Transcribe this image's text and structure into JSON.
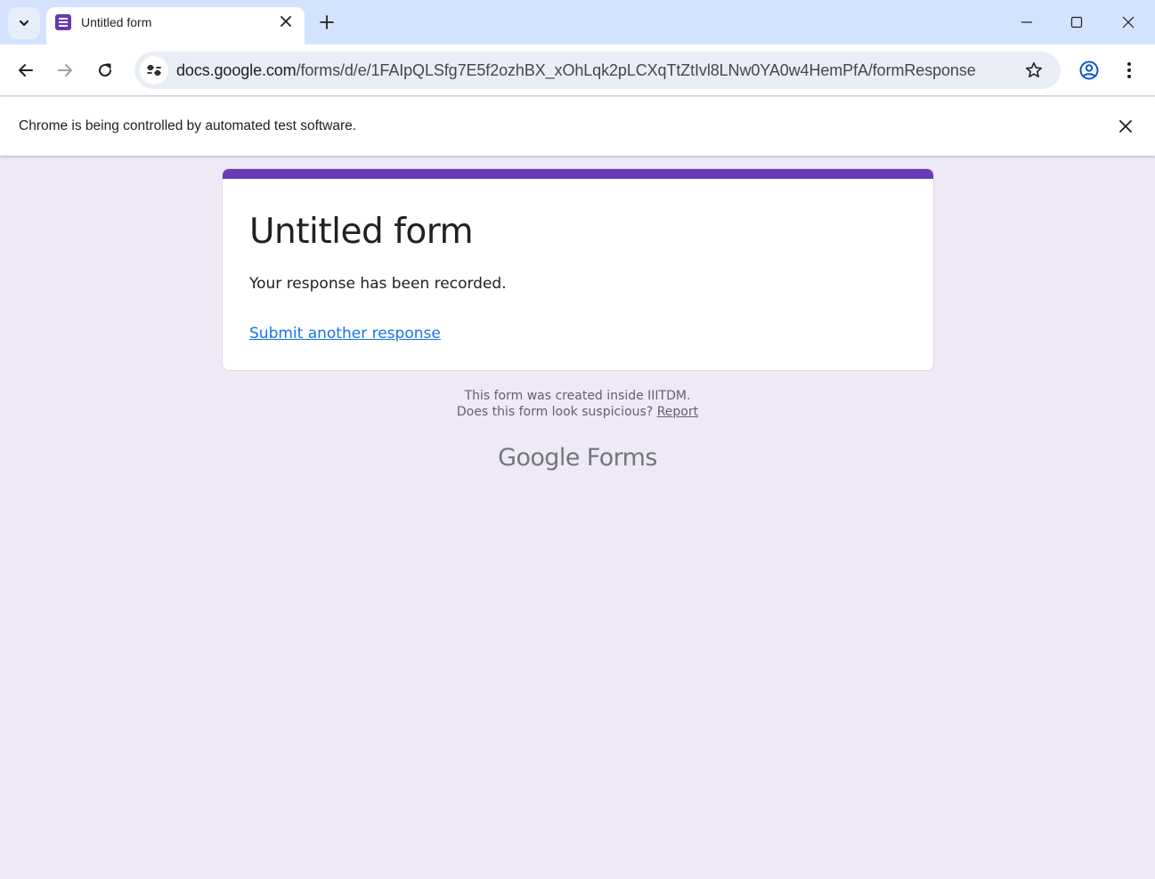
{
  "browser": {
    "tab": {
      "title": "Untitled form"
    },
    "address_bar": {
      "host": "docs.google.com",
      "path": "/forms/d/e/1FAIpQLSfg7E5f2ozhBX_xOhLqk2pLCXqTtZtIvl8LNw0YA0w4HemPfA/formResponse"
    },
    "infobar": {
      "message": "Chrome is being controlled by automated test software."
    },
    "icons": {
      "tab_search": "chevron-down-icon",
      "favicon": "google-forms-icon",
      "tab_close": "close-icon",
      "new_tab": "plus-icon",
      "minimize": "minimize-icon",
      "maximize": "maximize-icon",
      "close_window": "close-icon",
      "back": "arrow-left-icon",
      "forward": "arrow-right-icon",
      "reload": "reload-icon",
      "site_info": "tune-icon",
      "bookmark": "star-icon",
      "profile": "account-circle-icon",
      "menu": "more-vert-icon"
    }
  },
  "form": {
    "title": "Untitled form",
    "confirmation": "Your response has been recorded.",
    "submit_another": "Submit another response",
    "accent_color": "#673ab7"
  },
  "footer": {
    "created_inside": "This form was created inside IIITDM.",
    "suspicious": "Does this form look suspicious?",
    "report": "Report",
    "logo_google": "Google",
    "logo_forms": "Forms"
  }
}
